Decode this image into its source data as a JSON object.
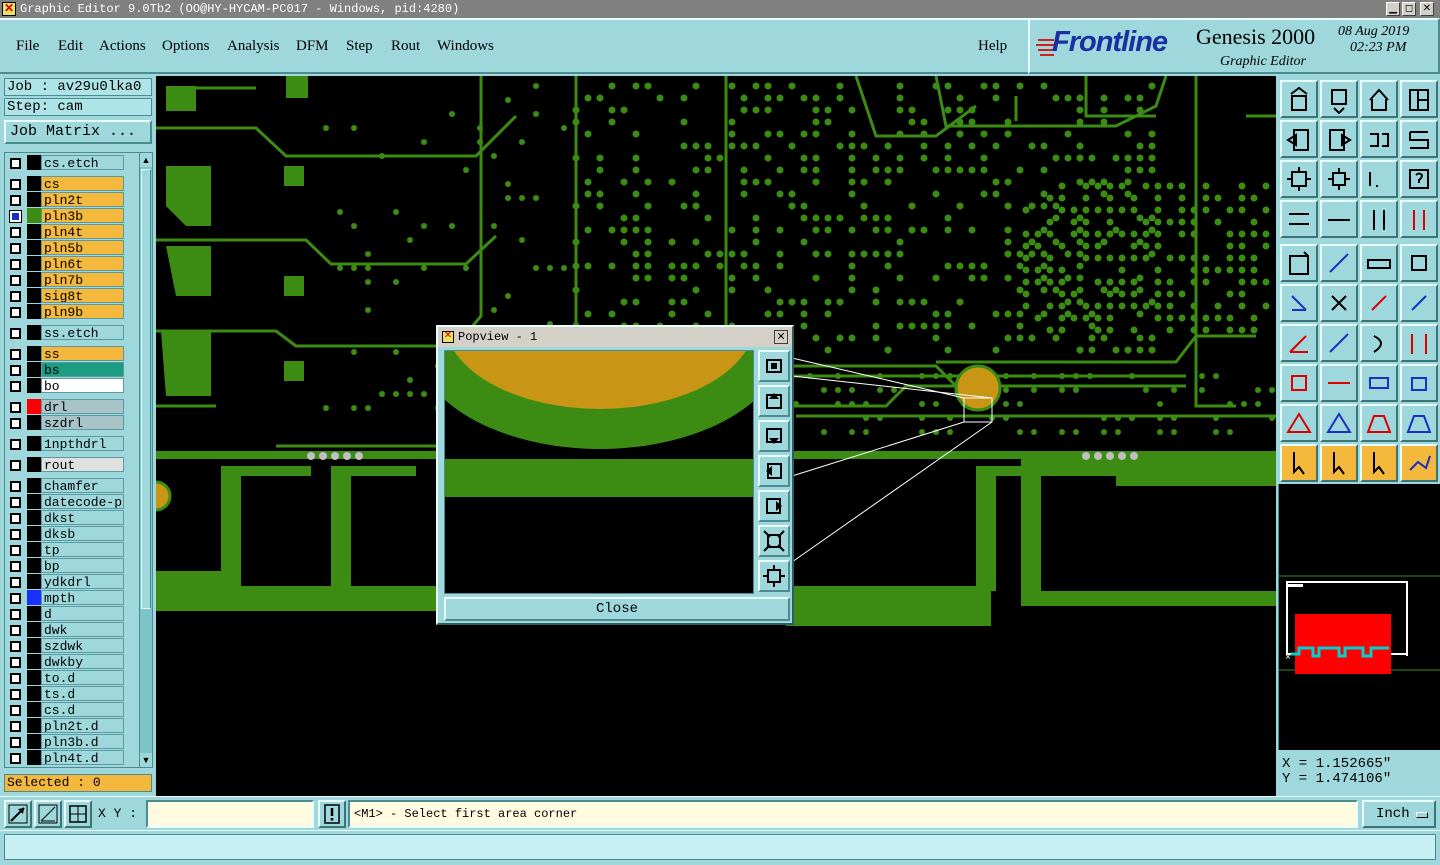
{
  "window": {
    "title": "Graphic Editor 9.0Tb2 (OO@HY-HYCAM-PC017 - Windows, pid:4280)",
    "icon": "x-app-icon"
  },
  "menu": {
    "items": [
      {
        "label": "File"
      },
      {
        "label": "Edit"
      },
      {
        "label": "Actions"
      },
      {
        "label": "Options"
      },
      {
        "label": "Analysis"
      },
      {
        "label": "DFM"
      },
      {
        "label": "Step"
      },
      {
        "label": "Rout"
      },
      {
        "label": "Windows"
      }
    ],
    "help": "Help"
  },
  "brand": {
    "logo": "Frontline",
    "product": "Genesis 2000",
    "date": "08 Aug 2019",
    "time": "02:23 PM",
    "subtitle": "Graphic Editor"
  },
  "job": {
    "job_label": "Job : av29u0lka0",
    "step_label": "Step: cam",
    "matrix_button": "Job Matrix ..."
  },
  "layers": [
    {
      "name": "cs.etch",
      "color": "#9ed8dc",
      "swatch": "",
      "checked": false
    },
    {
      "name": "cs",
      "color": "#f4b83c",
      "swatch": "",
      "checked": false
    },
    {
      "name": "pln2t",
      "color": "#f4b83c",
      "swatch": "",
      "checked": false
    },
    {
      "name": "pln3b",
      "color": "#f4b83c",
      "swatch": "#3c8c14",
      "checked": true
    },
    {
      "name": "pln4t",
      "color": "#f4b83c",
      "swatch": "",
      "checked": false
    },
    {
      "name": "pln5b",
      "color": "#f4b83c",
      "swatch": "",
      "checked": false
    },
    {
      "name": "pln6t",
      "color": "#f4b83c",
      "swatch": "",
      "checked": false
    },
    {
      "name": "pln7b",
      "color": "#f4b83c",
      "swatch": "",
      "checked": false
    },
    {
      "name": "sig8t",
      "color": "#f4b83c",
      "swatch": "",
      "checked": false
    },
    {
      "name": "pln9b",
      "color": "#f4b83c",
      "swatch": "",
      "checked": false
    },
    {
      "name": "ss.etch",
      "color": "#9ed8dc",
      "swatch": "",
      "checked": false
    },
    {
      "name": "ss",
      "color": "#f4b83c",
      "swatch": "",
      "checked": false
    },
    {
      "name": "bs",
      "color": "#1c9c80",
      "swatch": "",
      "checked": false
    },
    {
      "name": "bo",
      "color": "#ffffff",
      "swatch": "",
      "checked": false
    },
    {
      "name": "drl",
      "color": "#a8c4c8",
      "swatch": "#ff0000",
      "checked": false
    },
    {
      "name": "szdrl",
      "color": "#a8c4c8",
      "swatch": "",
      "checked": false
    },
    {
      "name": "1npthdrl",
      "color": "#9ed8dc",
      "swatch": "",
      "checked": false
    },
    {
      "name": "rout",
      "color": "#e0e0e0",
      "swatch": "",
      "checked": false
    },
    {
      "name": "chamfer",
      "color": "#9ed8dc",
      "swatch": "",
      "checked": false
    },
    {
      "name": "datecode-pto",
      "color": "#9ed8dc",
      "swatch": "",
      "checked": false
    },
    {
      "name": "dkst",
      "color": "#9ed8dc",
      "swatch": "",
      "checked": false
    },
    {
      "name": "dksb",
      "color": "#9ed8dc",
      "swatch": "",
      "checked": false
    },
    {
      "name": "tp",
      "color": "#9ed8dc",
      "swatch": "",
      "checked": false
    },
    {
      "name": "bp",
      "color": "#9ed8dc",
      "swatch": "",
      "checked": false
    },
    {
      "name": "ydkdrl",
      "color": "#9ed8dc",
      "swatch": "",
      "checked": false
    },
    {
      "name": "mpth",
      "color": "#9ed8dc",
      "swatch": "#1a30ff",
      "checked": false
    },
    {
      "name": "d",
      "color": "#9ed8dc",
      "swatch": "",
      "checked": false
    },
    {
      "name": "dwk",
      "color": "#9ed8dc",
      "swatch": "",
      "checked": false
    },
    {
      "name": "szdwk",
      "color": "#9ed8dc",
      "swatch": "",
      "checked": false
    },
    {
      "name": "dwkby",
      "color": "#9ed8dc",
      "swatch": "",
      "checked": false
    },
    {
      "name": "to.d",
      "color": "#9ed8dc",
      "swatch": "",
      "checked": false
    },
    {
      "name": "ts.d",
      "color": "#9ed8dc",
      "swatch": "",
      "checked": false
    },
    {
      "name": "cs.d",
      "color": "#9ed8dc",
      "swatch": "",
      "checked": false
    },
    {
      "name": "pln2t.d",
      "color": "#9ed8dc",
      "swatch": "",
      "checked": false
    },
    {
      "name": "pln3b.d",
      "color": "#9ed8dc",
      "swatch": "",
      "checked": false
    },
    {
      "name": "pln4t.d",
      "color": "#9ed8dc",
      "swatch": "",
      "checked": false
    }
  ],
  "selected": "Selected : 0",
  "popview": {
    "title": "Popview - 1",
    "close": "Close"
  },
  "coords": {
    "x": "X = 1.152665\"",
    "y": "Y = 1.474106\""
  },
  "status": {
    "xy_label": "X Y :",
    "xy_value": "",
    "message": "<M1> - Select first area corner",
    "units": "Inch"
  },
  "colors": {
    "copper": "#3c8c14",
    "pad": "#c89614",
    "background": "#000000",
    "panel": "#9ed8dc",
    "highlight": "#f4b83c"
  }
}
